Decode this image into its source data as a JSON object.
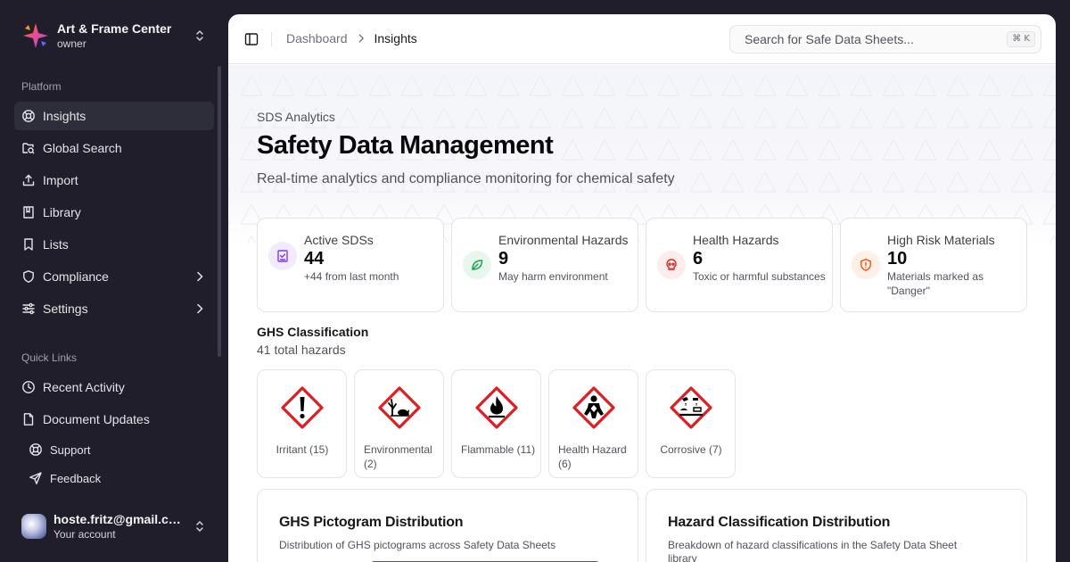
{
  "org": {
    "name": "Art & Frame Center",
    "role": "owner"
  },
  "sidebar": {
    "platform_label": "Platform",
    "items": [
      {
        "label": "Insights",
        "icon": "insights-icon",
        "active": true
      },
      {
        "label": "Global Search",
        "icon": "global-search-icon"
      },
      {
        "label": "Import",
        "icon": "upload-icon"
      },
      {
        "label": "Library",
        "icon": "book-icon"
      },
      {
        "label": "Lists",
        "icon": "bookmark-icon"
      },
      {
        "label": "Compliance",
        "icon": "shield-icon",
        "expandable": true
      },
      {
        "label": "Settings",
        "icon": "settings-icon",
        "expandable": true
      }
    ],
    "quick_links_label": "Quick Links",
    "quick_links": [
      {
        "label": "Recent Activity",
        "icon": "clock-icon"
      },
      {
        "label": "Document Updates",
        "icon": "document-icon"
      }
    ],
    "secondary": [
      {
        "label": "Support",
        "icon": "lifebuoy-icon"
      },
      {
        "label": "Feedback",
        "icon": "send-icon"
      }
    ]
  },
  "account": {
    "email": "hoste.fritz@gmail.com",
    "subtitle": "Your account"
  },
  "header": {
    "breadcrumb": [
      "Dashboard",
      "Insights"
    ],
    "search_placeholder": "Search for Safe Data Sheets...",
    "search_shortcut": "⌘ K"
  },
  "hero": {
    "eyebrow": "SDS Analytics",
    "title": "Safety Data Management",
    "subtitle": "Real-time analytics and compliance monitoring for chemical safety"
  },
  "stats": [
    {
      "label": "Active SDSs",
      "value": "44",
      "note": "+44 from last month",
      "color": "#7c3aed",
      "bg": "#f1ebfd"
    },
    {
      "label": "Environmental Hazards",
      "value": "9",
      "note": "May harm environment",
      "color": "#16a34a",
      "bg": "#e8f7ee"
    },
    {
      "label": "Health Hazards",
      "value": "6",
      "note": "Toxic or harmful substances",
      "color": "#dc2626",
      "bg": "#fdecec"
    },
    {
      "label": "High Risk Materials",
      "value": "10",
      "note": "Materials marked as \"Danger\"",
      "color": "#ea580c",
      "bg": "#fdf0e6"
    }
  ],
  "ghs": {
    "title": "GHS Classification",
    "count": "41 total hazards",
    "pictograms": [
      {
        "label": "Irritant (15)",
        "icon": "exclamation-mark-pictogram-icon"
      },
      {
        "label": "Environmental (2)",
        "icon": "environment-pictogram-icon"
      },
      {
        "label": "Flammable (11)",
        "icon": "flame-pictogram-icon"
      },
      {
        "label": "Health Hazard (6)",
        "icon": "health-hazard-pictogram-icon"
      },
      {
        "label": "Corrosive (7)",
        "icon": "corrosion-pictogram-icon"
      }
    ]
  },
  "cards": [
    {
      "title": "GHS Pictogram Distribution",
      "description": "Distribution of GHS pictograms across Safety Data Sheets"
    },
    {
      "title": "Hazard Classification Distribution",
      "description": "Breakdown of hazard classifications in the Safety Data Sheet library"
    }
  ],
  "colors": {
    "sidebar_bg": "#1f1e2a",
    "ghs_red": "#e11d24"
  }
}
